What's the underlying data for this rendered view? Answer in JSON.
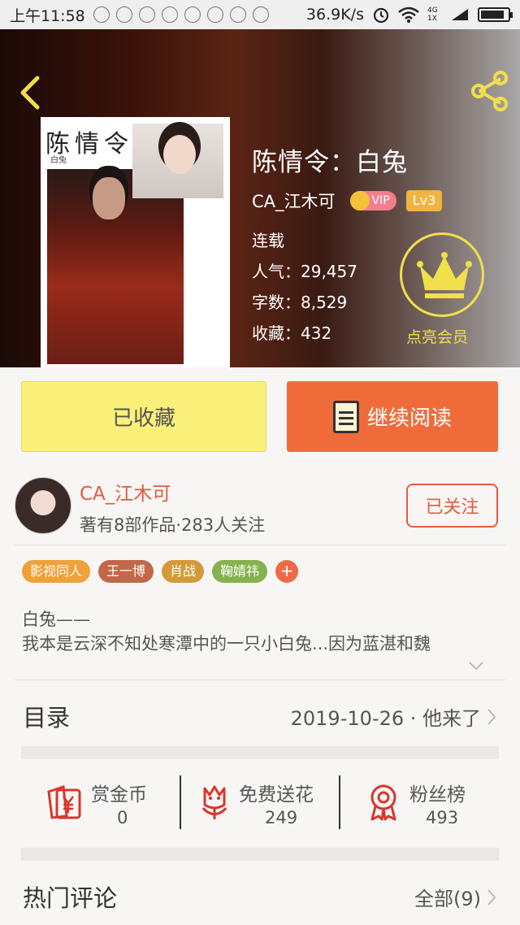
{
  "status_bar": {
    "time": "上午11:58",
    "net_speed": "36.9K/s",
    "network": "4G 1X"
  },
  "book": {
    "title": "陈情令：白兔",
    "author": "CA_江木可",
    "vip_label": "VIP",
    "level": "Lv3",
    "status": "连载",
    "popularity": "人气：29,457",
    "word_count": "字数：8,529",
    "favorites": "收藏：432",
    "member_label": "点亮会员",
    "cover_title": "陈情令",
    "cover_subtitle": "白兔"
  },
  "actions": {
    "favorited": "已收藏",
    "continue_reading": "继续阅读"
  },
  "author_card": {
    "name": "CA_江木可",
    "meta": "著有8部作品·283人关注",
    "follow_label": "已关注"
  },
  "tags": [
    {
      "label": "影视同人",
      "color": "#f0a13a"
    },
    {
      "label": "王一博",
      "color": "#c2674a"
    },
    {
      "label": "肖战",
      "color": "#d49a3a"
    },
    {
      "label": "鞠婧祎",
      "color": "#86b24d"
    }
  ],
  "tag_more": "+",
  "description": {
    "line1": "白兔——",
    "line2": "我本是云深不知处寒潭中的一只小白兔...因为蓝湛和魏"
  },
  "catalog": {
    "label": "目录",
    "latest": "2019-10-26 · 他来了"
  },
  "stats": [
    {
      "label": "赏金币",
      "value": "0",
      "icon": "red-envelope-icon"
    },
    {
      "label": "免费送花",
      "value": "249",
      "icon": "flower-icon"
    },
    {
      "label": "粉丝榜",
      "value": "493",
      "icon": "medal-icon"
    }
  ],
  "comments": {
    "label": "热门评论",
    "all": "全部(9)"
  },
  "colors": {
    "accent": "#e45a3e",
    "fav_button": "#fbf07a",
    "read_button": "#ef6c3a",
    "member_gold": "#f1df4c"
  }
}
